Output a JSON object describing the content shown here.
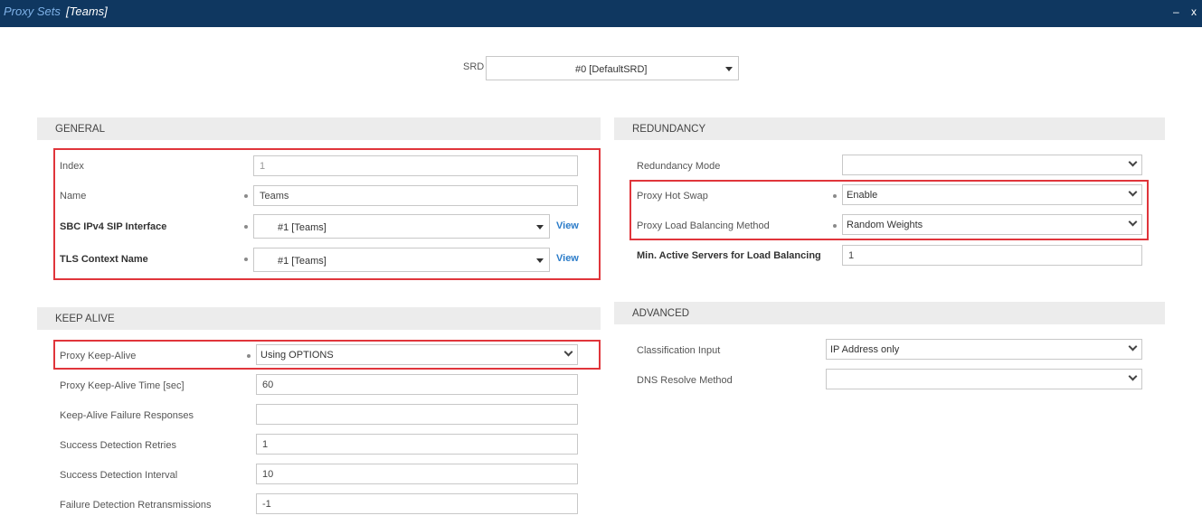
{
  "window": {
    "title": "Proxy Sets",
    "subtitle": "[Teams]",
    "minimize": "–",
    "close": "x"
  },
  "srd": {
    "label": "SRD",
    "value": "#0 [DefaultSRD]"
  },
  "general": {
    "header": "GENERAL",
    "index": {
      "label": "Index",
      "value": "1"
    },
    "name": {
      "label": "Name",
      "value": "Teams"
    },
    "sip_interface": {
      "label": "SBC IPv4 SIP Interface",
      "value": "#1 [Teams]",
      "link": "View"
    },
    "tls_context": {
      "label": "TLS Context Name",
      "value": "#1 [Teams]",
      "link": "View"
    }
  },
  "keep_alive": {
    "header": "KEEP ALIVE",
    "proxy_keep_alive": {
      "label": "Proxy Keep-Alive",
      "value": "Using OPTIONS"
    },
    "keep_alive_time": {
      "label": "Proxy Keep-Alive Time [sec]",
      "value": "60"
    },
    "failure_responses": {
      "label": "Keep-Alive Failure Responses",
      "value": ""
    },
    "success_retries": {
      "label": "Success Detection Retries",
      "value": "1"
    },
    "success_interval": {
      "label": "Success Detection Interval",
      "value": "10"
    },
    "failure_retrans": {
      "label": "Failure Detection Retransmissions",
      "value": "-1"
    }
  },
  "redundancy": {
    "header": "REDUNDANCY",
    "mode": {
      "label": "Redundancy Mode",
      "value": ""
    },
    "hot_swap": {
      "label": "Proxy Hot Swap",
      "value": "Enable"
    },
    "lb_method": {
      "label": "Proxy Load Balancing Method",
      "value": "Random Weights"
    },
    "min_active": {
      "label": "Min. Active Servers for Load Balancing",
      "value": "1"
    }
  },
  "advanced": {
    "header": "ADVANCED",
    "classification": {
      "label": "Classification Input",
      "value": "IP Address only"
    },
    "dns_method": {
      "label": "DNS Resolve Method",
      "value": ""
    }
  },
  "colors": {
    "titlebar": "#0f3760",
    "highlight": "#e0353b",
    "link": "#2b7cc9",
    "section": "#ececec"
  }
}
